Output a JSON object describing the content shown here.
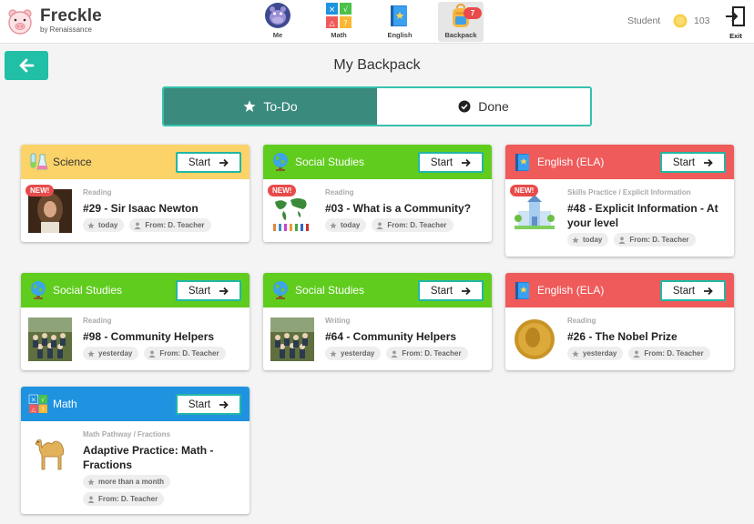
{
  "brand": {
    "name": "Freckle",
    "sub": "by Renaissance"
  },
  "nav": [
    {
      "label": "Me",
      "icon": "hippo-avatar-icon"
    },
    {
      "label": "Math",
      "icon": "math-icon"
    },
    {
      "label": "English",
      "icon": "book-icon"
    },
    {
      "label": "Backpack",
      "icon": "backpack-icon",
      "badge": "7",
      "active": true
    }
  ],
  "user": {
    "role": "Student",
    "coins": "103"
  },
  "exit": {
    "label": "Exit"
  },
  "page": {
    "title": "My Backpack"
  },
  "toggle": {
    "todo": "To-Do",
    "done": "Done"
  },
  "start_label": "Start",
  "colors": {
    "science": "#fbd369",
    "social": "#5fcc1e",
    "ela": "#ef5a5a",
    "math": "#1f93e0",
    "accent": "#21bfa5",
    "toggle_active": "#3a8a7e"
  },
  "cards": [
    {
      "subject": "Science",
      "type": "Reading",
      "title": "#29 - Sir Isaac Newton",
      "date": "today",
      "from": "From: D. Teacher",
      "new": "NEW!"
    },
    {
      "subject": "Social Studies",
      "type": "Reading",
      "title": "#03 - What is a Community?",
      "date": "today",
      "from": "From: D. Teacher",
      "new": "NEW!"
    },
    {
      "subject": "English (ELA)",
      "type": "Skills Practice / Explicit Information",
      "title": "#48 - Explicit Information - At your level",
      "date": "today",
      "from": "From: D. Teacher",
      "new": "NEW!"
    },
    {
      "subject": "Social Studies",
      "type": "Reading",
      "title": "#98 - Community Helpers",
      "date": "yesterday",
      "from": "From: D. Teacher"
    },
    {
      "subject": "Social Studies",
      "type": "Writing",
      "title": "#64 - Community Helpers",
      "date": "yesterday",
      "from": "From: D. Teacher"
    },
    {
      "subject": "English (ELA)",
      "type": "Reading",
      "title": "#26 - The Nobel Prize",
      "date": "yesterday",
      "from": "From: D. Teacher"
    },
    {
      "subject": "Math",
      "type": "Math Pathway / Fractions",
      "title": "Adaptive Practice: Math - Fractions",
      "date": "more than a month",
      "from": "From: D. Teacher"
    }
  ]
}
